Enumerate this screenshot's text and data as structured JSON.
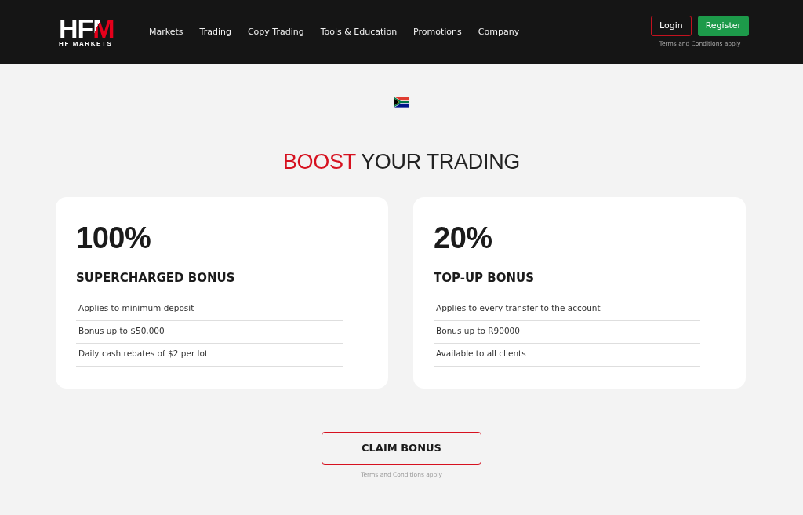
{
  "header": {
    "logo": {
      "wordmark": "HFM",
      "tagline": "HF MARKETS"
    },
    "nav": [
      "Markets",
      "Trading",
      "Copy Trading",
      "Tools & Education",
      "Promotions",
      "Company"
    ],
    "login": "Login",
    "register": "Register",
    "terms": "Terms and Conditions apply"
  },
  "hero": {
    "heading": {
      "accent": "BOOST",
      "rest": "YOUR TRADING"
    }
  },
  "offers": [
    {
      "amount": "100%",
      "title": "SUPERCHARGED BONUS",
      "features": [
        "Applies to minimum deposit",
        "Bonus up to $50,000",
        "Daily cash rebates of $2 per lot"
      ]
    },
    {
      "amount": "20%",
      "title": "TOP-UP BONUS",
      "features": [
        "Applies to every transfer to the account",
        "Bonus up to R90000",
        "Available to all clients"
      ]
    }
  ],
  "cta": {
    "label": "CLAIM BONUS",
    "terms": "Terms and Conditions apply"
  }
}
